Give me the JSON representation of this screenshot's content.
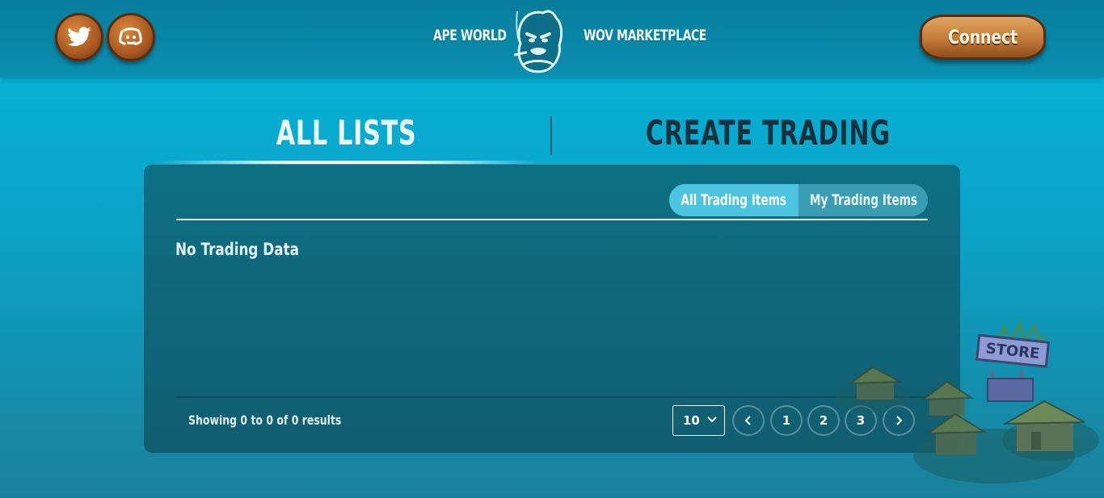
{
  "header": {
    "social": [
      {
        "name": "twitter",
        "icon": "twitter-icon"
      },
      {
        "name": "discord",
        "icon": "discord-icon"
      }
    ],
    "nav_left": "APE WORLD",
    "nav_right": "WOV MARKETPLACE",
    "logo_icon": "ape-logo-icon",
    "connect_label": "Connect"
  },
  "tabs": {
    "all_lists": "ALL LISTS",
    "create_trading": "CREATE TRADING",
    "active": "all_lists"
  },
  "panel": {
    "toggle": {
      "all_items": "All Trading Items",
      "my_items": "My Trading Items",
      "active": "all_items"
    },
    "empty_message": "No Trading Data",
    "showing_text": "Showing 0 to 0 of 0 results",
    "page_size": "10",
    "pages": [
      "1",
      "2",
      "3"
    ]
  },
  "decoration": {
    "store_sign": "STORE"
  },
  "colors": {
    "header_bg": "#087d9c",
    "page_bg": "#06b6dc",
    "panel_bg": "#0e6f84",
    "toggle_active": "#4cc3df",
    "create_tab_text": "#16303c",
    "connect_wood": "#c27a36"
  }
}
